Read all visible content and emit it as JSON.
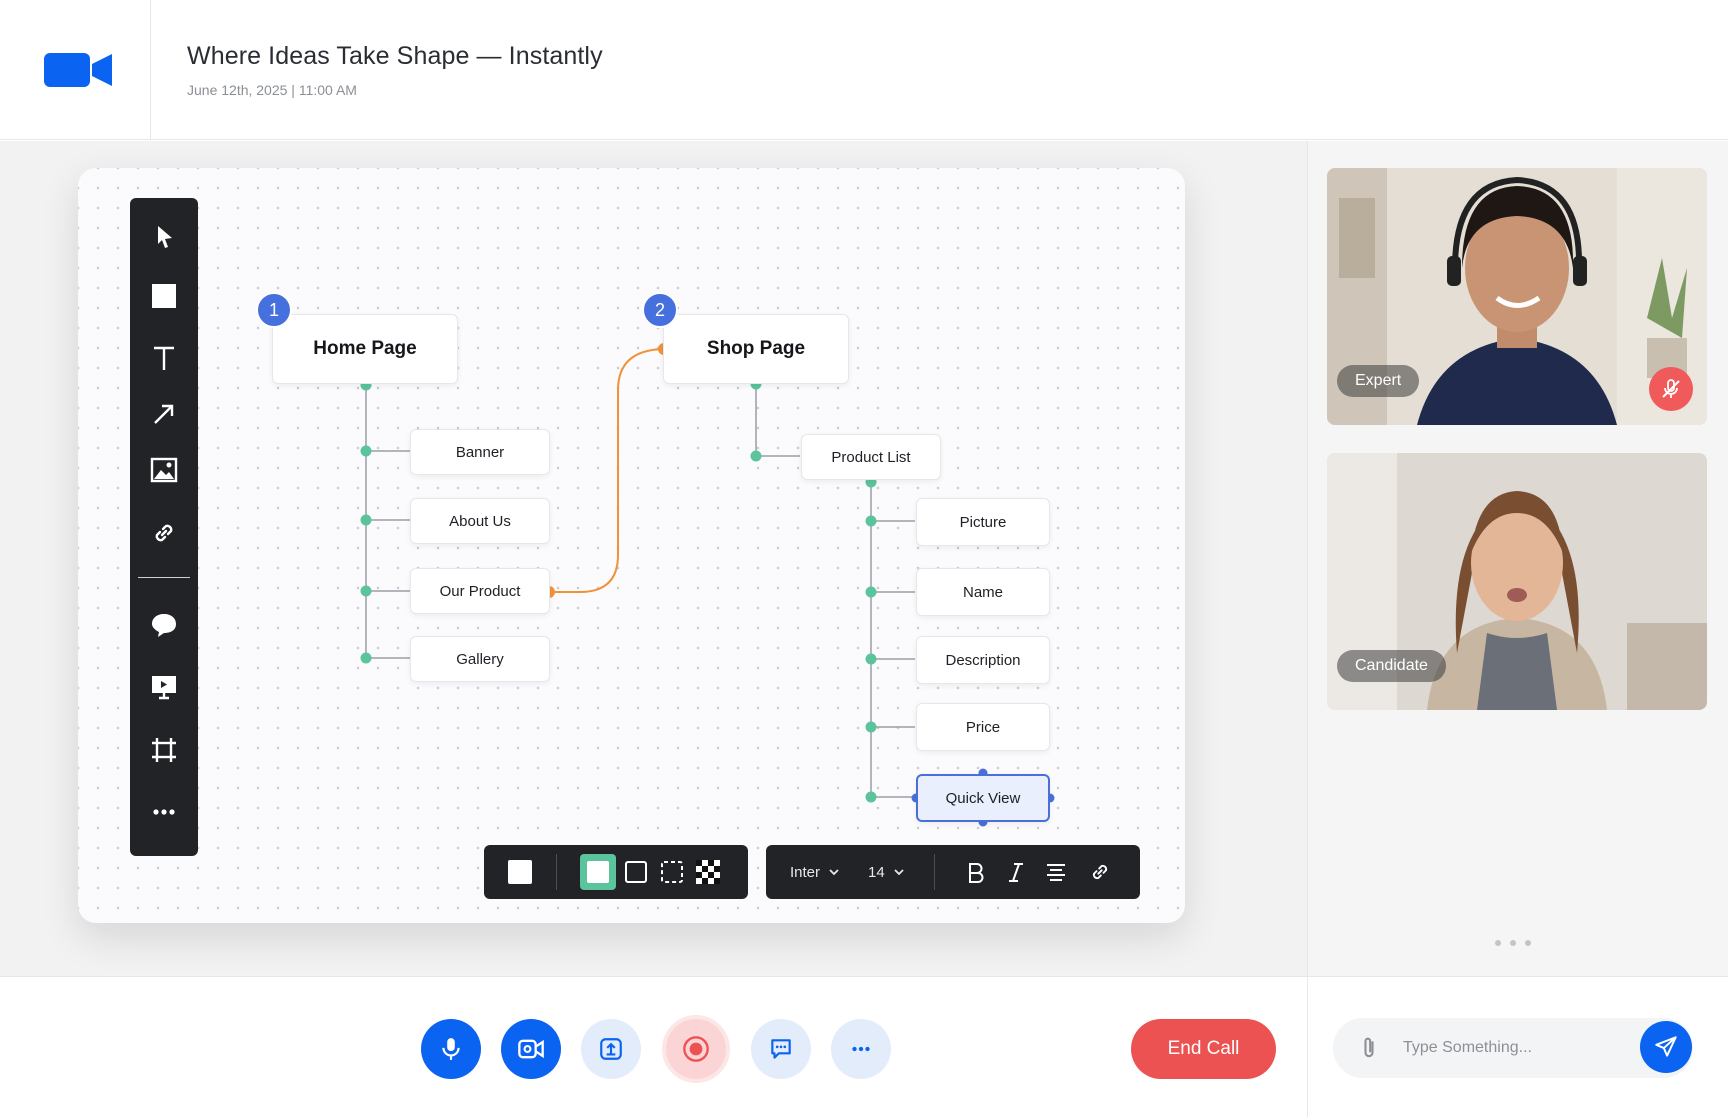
{
  "header": {
    "title": "Where Ideas Take Shape — Instantly",
    "datetime": "June 12th, 2025 | 11:00 AM",
    "logo_icon": "video-camera-icon"
  },
  "toolbar": {
    "tools": [
      "pointer-icon",
      "rectangle-icon",
      "text-icon",
      "arrow-icon",
      "image-icon",
      "link-icon",
      "comment-icon",
      "present-icon",
      "frame-icon",
      "more-icon"
    ]
  },
  "diagram": {
    "home": {
      "badge": "1",
      "label": "Home Page",
      "children": [
        "Banner",
        "About Us",
        "Our Product",
        "Gallery"
      ]
    },
    "shop": {
      "badge": "2",
      "label": "Shop Page",
      "child": "Product List",
      "product_children": [
        "Picture",
        "Name",
        "Description",
        "Price",
        "Quick View"
      ]
    },
    "selected_node": "Quick View",
    "connector_color": "#f0923a",
    "tree_dot_color": "#5cc49c",
    "selection_color": "#4a6fd8"
  },
  "format_toolbar": {
    "font": "Inter",
    "size": "14",
    "fill_options": [
      "solid",
      "outline",
      "dashed",
      "transparent"
    ],
    "active_fill": "solid",
    "text_tools": [
      "bold-icon",
      "italic-icon",
      "align-icon",
      "link-icon"
    ]
  },
  "participants": [
    {
      "label": "Expert",
      "muted": true
    },
    {
      "label": "Candidate",
      "muted": false
    }
  ],
  "controls": {
    "buttons": [
      "mic-icon",
      "camera-icon",
      "share-screen-icon",
      "record-icon",
      "chat-icon",
      "more-icon"
    ],
    "end_call": "End Call"
  },
  "chat": {
    "placeholder": "Type Something..."
  },
  "colors": {
    "primary": "#0b63f1",
    "danger": "#ec5252",
    "badge": "#4570dd"
  }
}
